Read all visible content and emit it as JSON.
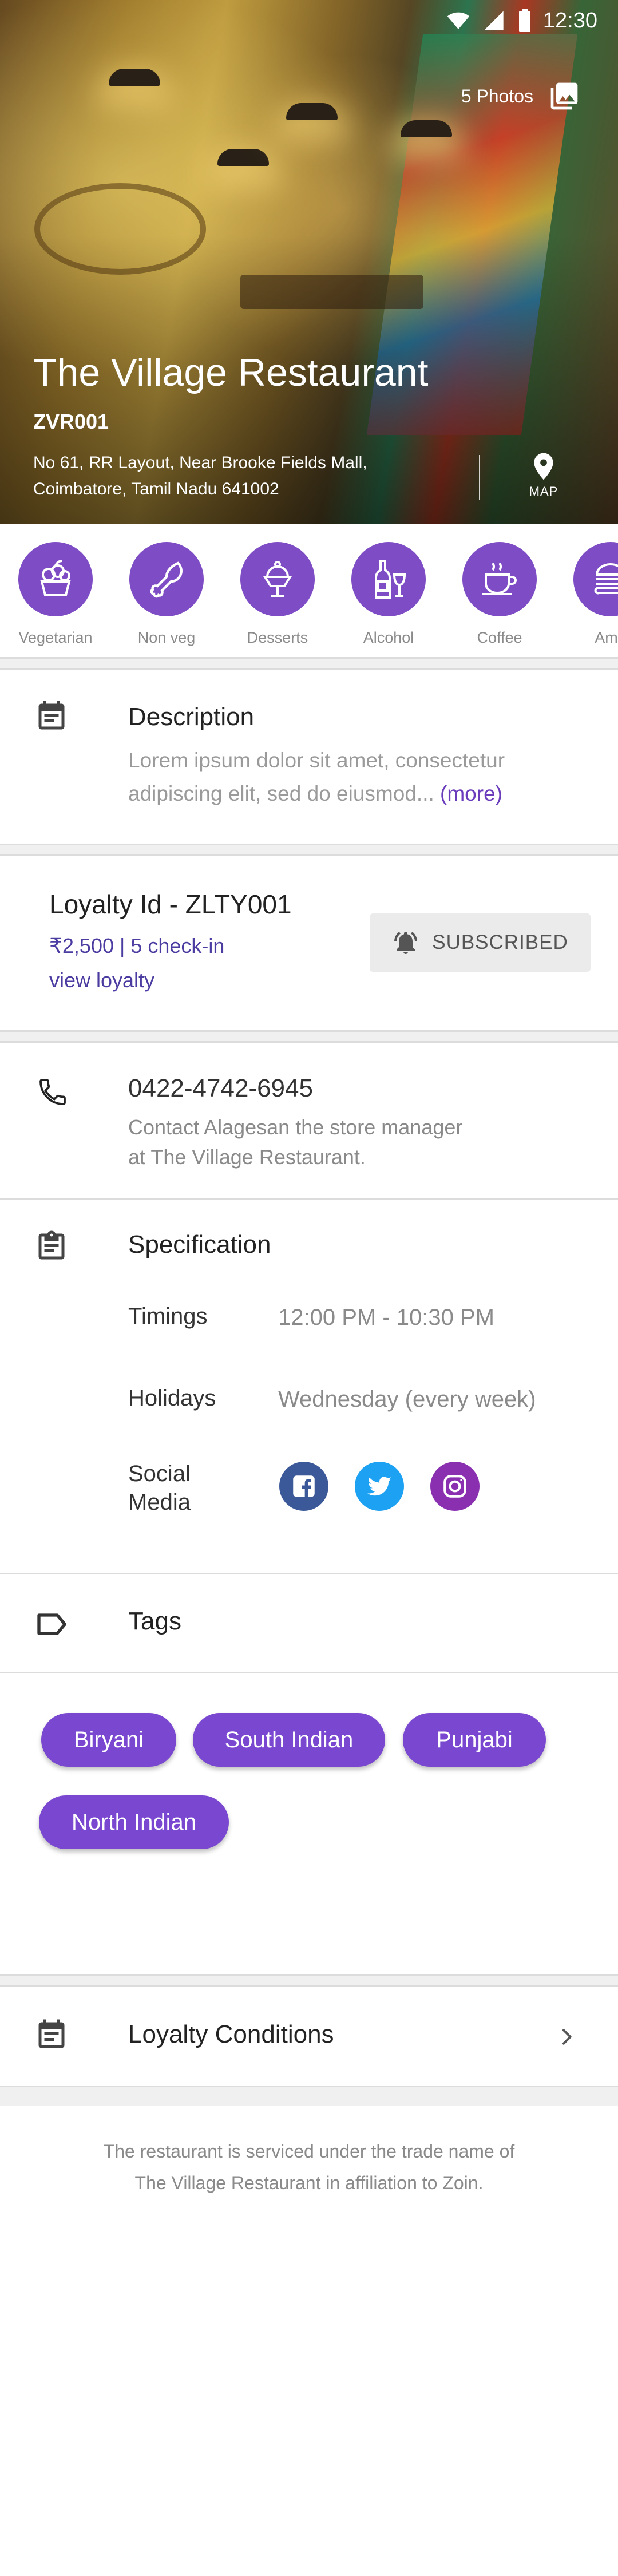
{
  "status_bar": {
    "time": "12:30"
  },
  "hero": {
    "photos_label": "5 Photos",
    "title": "The Village Restaurant",
    "code": "ZVR001",
    "address": "No 61, RR Layout, Near Brooke Fields Mall, Coimbatore, Tamil Nadu 641002",
    "map_label": "MAP"
  },
  "categories": [
    {
      "label": "Vegetarian",
      "icon": "vegetarian-icon"
    },
    {
      "label": "Non veg",
      "icon": "chicken-leg-icon"
    },
    {
      "label": "Desserts",
      "icon": "ice-cream-icon"
    },
    {
      "label": "Alcohol",
      "icon": "wine-bottle-icon"
    },
    {
      "label": "Coffee",
      "icon": "coffee-cup-icon"
    },
    {
      "label": "Ame",
      "icon": "burger-icon"
    }
  ],
  "description": {
    "title": "Description",
    "text": "Lorem ipsum dolor sit amet, consectetur adipiscing elit, sed do eiusmod...",
    "more_label": "(more)"
  },
  "loyalty": {
    "title": "Loyalty Id - ZLTY001",
    "summary": "₹2,500 | 5 check-in",
    "link_label": "view loyalty",
    "subscribed_label": "SUBSCRIBED"
  },
  "contact": {
    "phone": "0422-4742-6945",
    "note_line1": "Contact Alagesan the store manager",
    "note_line2": "at The Village Restaurant."
  },
  "specification": {
    "title": "Specification",
    "rows": [
      {
        "label": "Timings",
        "value": "12:00 PM - 10:30 PM"
      },
      {
        "label": "Holidays",
        "value": "Wednesday (every week)"
      }
    ],
    "social_label_line1": "Social",
    "social_label_line2": "Media",
    "social_links": [
      {
        "icon": "facebook-icon",
        "color": "#3b5998"
      },
      {
        "icon": "twitter-icon",
        "color": "#1da1f2"
      },
      {
        "icon": "instagram-icon",
        "color": "#8a2fb0"
      }
    ]
  },
  "tags": {
    "title": "Tags",
    "items": [
      "Biryani",
      "South Indian",
      "Punjabi",
      "North Indian"
    ]
  },
  "loyalty_conditions": {
    "title": "Loyalty Conditions"
  },
  "footer": {
    "line1": "The restaurant is serviced under the trade name of",
    "line2": "The Village Restaurant in affiliation to Zoin."
  },
  "colors": {
    "accent": "#7a47d0",
    "link": "#4a3ca0",
    "muted": "#8a8a8a"
  }
}
